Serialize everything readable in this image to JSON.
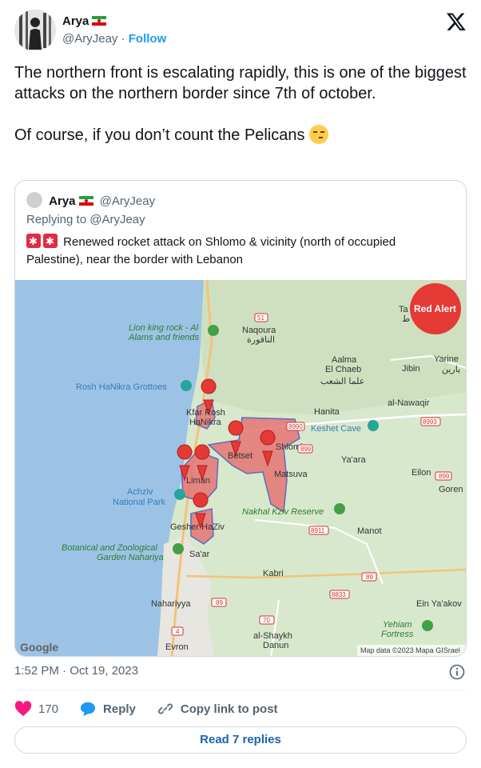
{
  "author": {
    "name": "Arya",
    "handle": "@AryJeay",
    "separator": "·",
    "follow_label": "Follow"
  },
  "tweet": {
    "paragraphs": [
      "The northern front is escalating rapidly, this is one of the biggest attacks on the northern border since 7th of october.",
      "Of course, if you don’t count the Pelicans"
    ]
  },
  "quote": {
    "name": "Arya",
    "handle": "@AryJeay",
    "replying_to": "Replying to @AryJeay",
    "text": "Renewed rocket attack on Shlomo & vicinity (north of occupied Palestine), near the border with Lebanon"
  },
  "map": {
    "brand_badge": "Red Alert",
    "google": "Google",
    "attribution": "Map data ©2023 Mapa GISrael",
    "labels": {
      "lion_king_1": "Lion king rock - Al",
      "lion_king_2": "Alams and friends",
      "naqoura": "Naqoura",
      "naqoura_ar": "الناقورة",
      "aalma_1": "Aalma",
      "aalma_2": "El Chaeb",
      "aalma_ar": "علما الشعب",
      "yarine": "Yarine",
      "yarine_ar": "يارين",
      "jibin": "Jibin",
      "rosh": "Rosh HaNikra Grottoes",
      "alnawaqir": "al-Nawaqir",
      "kfar_1": "Kfar Rosh",
      "kfar_2": "HaNikra",
      "hanita": "Hanita",
      "keshet": "Keshet Cave",
      "shlomi": "Shlomi",
      "betset": "Betset",
      "yaara": "Ya'ara",
      "matsuva": "Matsuva",
      "eilon": "Eilon",
      "goren": "Goren",
      "liman": "Liman",
      "achziv_1": "Achziv",
      "achziv_2": "National Park",
      "nahal": "Nakhal Kziv Reserve",
      "gesher": "Gesher HaZiv",
      "manot": "Manot",
      "botanical_1": "Botanical and Zoological",
      "botanical_2": "Garden Nahariya",
      "saar": "Sa'ar",
      "kabri": "Kabri",
      "nahariyya": "Nahariyya",
      "ein": "Ein Ya'akov",
      "yehiam_1": "Yehiam",
      "yehiam_2": "Fortress",
      "shaykh_1": "al-Shaykh",
      "shaykh_2": "Danun",
      "evron": "Evron",
      "ta": "Ta",
      "ta_ar": "ط"
    },
    "roads": {
      "r51": "51",
      "r8990": "8990",
      "r899": "899",
      "r8993": "8993",
      "r899b": "899",
      "r8911": "8911",
      "r89a": "89",
      "r8833": "8833",
      "r89b": "89",
      "r70": "70",
      "r4": "4"
    }
  },
  "timestamp": "1:52 PM · Oct 19, 2023",
  "actions": {
    "likes": "170",
    "reply_label": "Reply",
    "copy_label": "Copy link to post"
  },
  "read_replies": "Read 7 replies",
  "colors": {
    "link": "#1d9bf0",
    "like": "#f91880",
    "alert": "#e53935"
  }
}
